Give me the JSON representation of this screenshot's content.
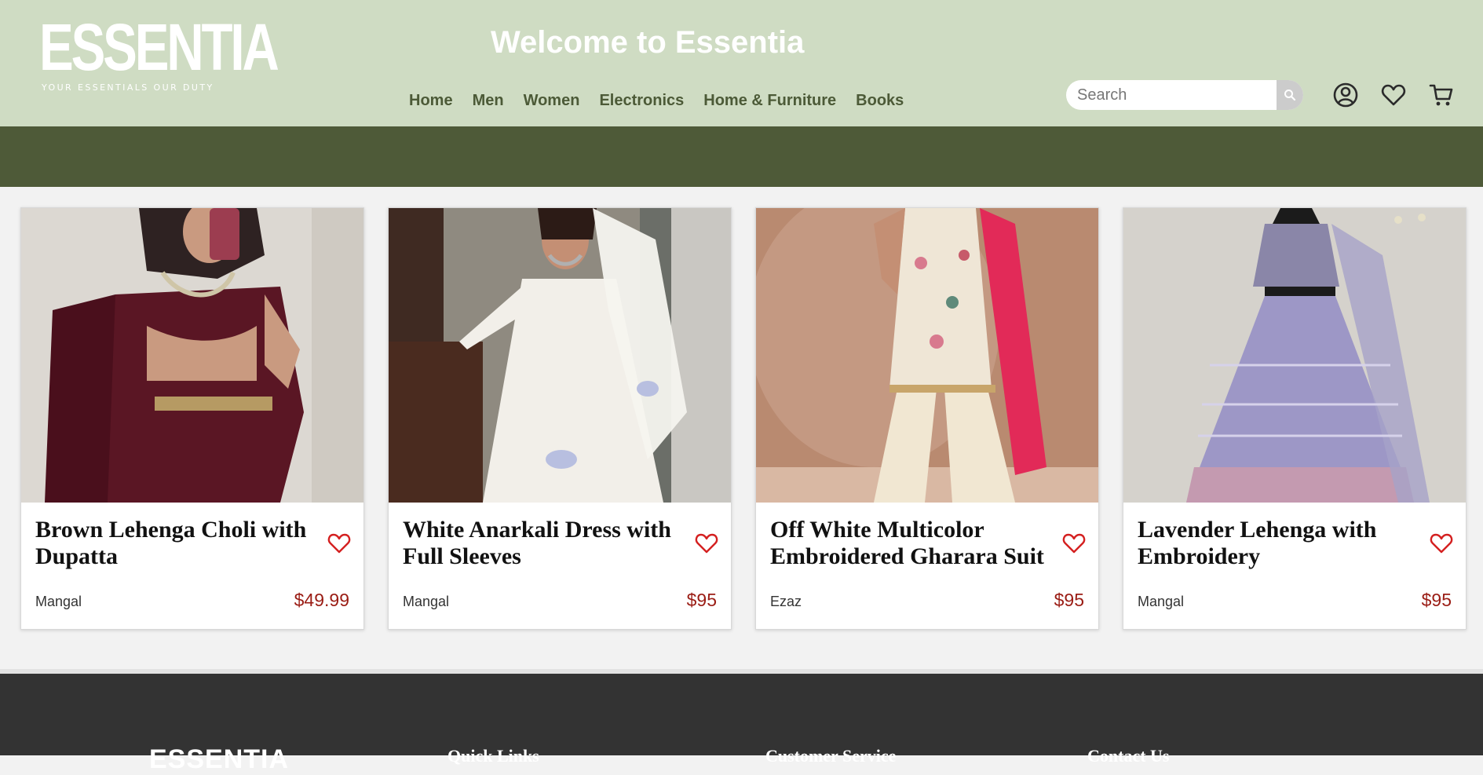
{
  "header": {
    "logo_word": "ESSENTIA",
    "logo_tagline": "YOUR ESSENTIALS OUR DUTY",
    "welcome": "Welcome to Essentia",
    "nav": [
      "Home",
      "Men",
      "Women",
      "Electronics",
      "Home & Furniture",
      "Books"
    ],
    "search_placeholder": "Search",
    "icons": [
      "search-icon",
      "account-icon",
      "wishlist-heart-icon",
      "cart-icon"
    ]
  },
  "colors": {
    "header_bg": "#cfdcc3",
    "band": "#4e5a38",
    "price": "#9a1c14",
    "heart": "#d42020",
    "footer": "#333333"
  },
  "products": [
    {
      "title": "Brown Lehenga Choli with Dupatta",
      "brand": "Mangal",
      "price": "$49.99"
    },
    {
      "title": "White Anarkali Dress with Full Sleeves",
      "brand": "Mangal",
      "price": "$95"
    },
    {
      "title": "Off White Multicolor Embroidered Gharara Suit",
      "brand": "Ezaz",
      "price": "$95"
    },
    {
      "title": "Lavender Lehenga with Embroidery",
      "brand": "Mangal",
      "price": "$95"
    }
  ],
  "footer": {
    "logo": "ESSENTIA",
    "columns": [
      "Quick Links",
      "Customer Service",
      "Contact Us"
    ]
  }
}
